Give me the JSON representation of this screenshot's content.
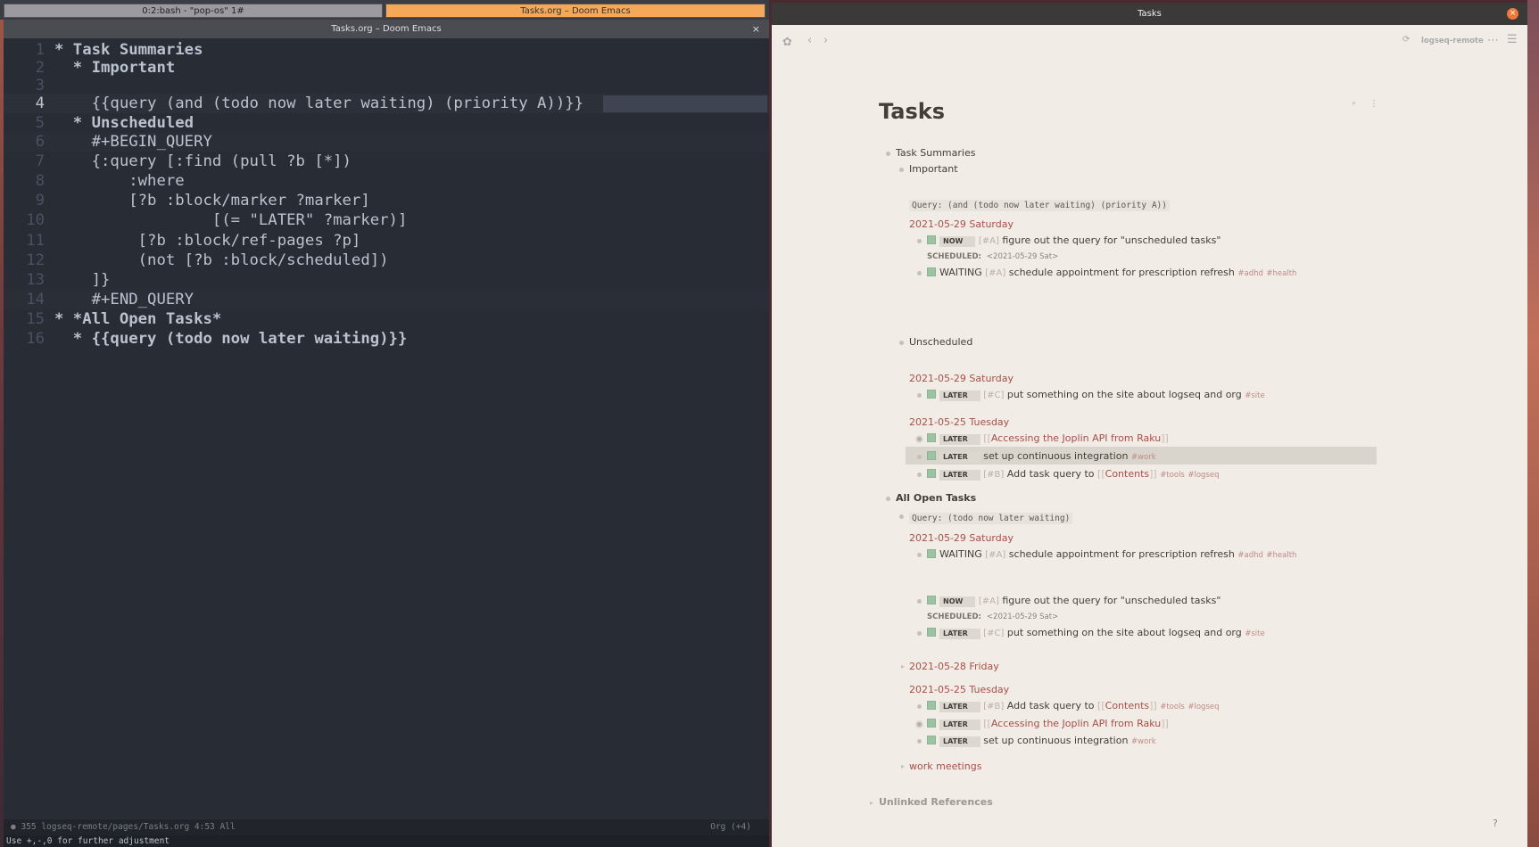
{
  "tmux": {
    "tab1": "0:2:bash - \"pop-os\" 1#",
    "tab2": "Tasks.org – Doom Emacs"
  },
  "emacs": {
    "title": "Tasks.org – Doom Emacs",
    "close": "×",
    "lines": [
      {
        "n": "1",
        "t": "* Task Summaries"
      },
      {
        "n": "2",
        "t": "  * Important"
      },
      {
        "n": "3",
        "t": ""
      },
      {
        "n": "4",
        "t": "    {{query (and (todo now later waiting) (priority A))}}"
      },
      {
        "n": "5",
        "t": "  * Unscheduled"
      },
      {
        "n": "6",
        "t": "    #+BEGIN_QUERY"
      },
      {
        "n": "7",
        "t": "    {:query [:find (pull ?b [*])"
      },
      {
        "n": "8",
        "t": "        :where"
      },
      {
        "n": "9",
        "t": "        [?b :block/marker ?marker]"
      },
      {
        "n": "10",
        "t": "                 [(= \"LATER\" ?marker)]"
      },
      {
        "n": "11",
        "t": "         [?b :block/ref-pages ?p]"
      },
      {
        "n": "12",
        "t": "         (not [?b :block/scheduled])"
      },
      {
        "n": "13",
        "t": "    ]}"
      },
      {
        "n": "14",
        "t": "    #+END_QUERY"
      },
      {
        "n": "15",
        "t": "* *All Open Tasks*"
      },
      {
        "n": "16",
        "t": "  * {{query (todo now later waiting)}}"
      }
    ],
    "modeline": {
      "left": "●  355  logseq-remote/pages/Tasks.org  4:53 All",
      "right": "Org (+4)"
    },
    "minibuffer": "Use +,-,0 for further adjustment"
  },
  "logseq": {
    "window_title": "Tasks",
    "close": "×",
    "sync_label": "logseq-remote",
    "page_title": "Tasks",
    "task_summaries": "Task Summaries",
    "important": "Important",
    "query1": "Query: (and (todo now later waiting) (priority A))",
    "date_0529_sat": "2021-05-29 Saturday",
    "date_0525_tue": "2021-05-25 Tuesday",
    "date_0528_fri": "2021-05-28 Friday",
    "now": "NOW",
    "later": "LATER",
    "waiting": "WAITING",
    "prA": "[#A]",
    "prB": "[#B]",
    "prC": "[#C]",
    "t_figure": "figure out the query for \"unscheduled tasks\"",
    "scheduled_label": "SCHEDULED:",
    "scheduled_val": "<2021-05-29 Sat>",
    "t_appt": "schedule appointment for prescription refresh",
    "tag_adhd": "#adhd",
    "tag_health": "#health",
    "tag_site": "#site",
    "tag_work": "#work",
    "tag_tools": "#tools",
    "tag_logseq": "#logseq",
    "unscheduled": "Unscheduled",
    "t_site": "put something on the site about logseq and org",
    "lb": "[[",
    "rb": "]]",
    "t_joplin": "Accessing the Joplin API from Raku",
    "t_ci": "set up continuous integration",
    "t_addq": "Add task query to",
    "contents": "Contents",
    "all_open": "All Open Tasks",
    "query2": "Query: (todo now later waiting)",
    "work_meetings": "work meetings",
    "unlinked": "Unlinked References",
    "help": "?"
  }
}
